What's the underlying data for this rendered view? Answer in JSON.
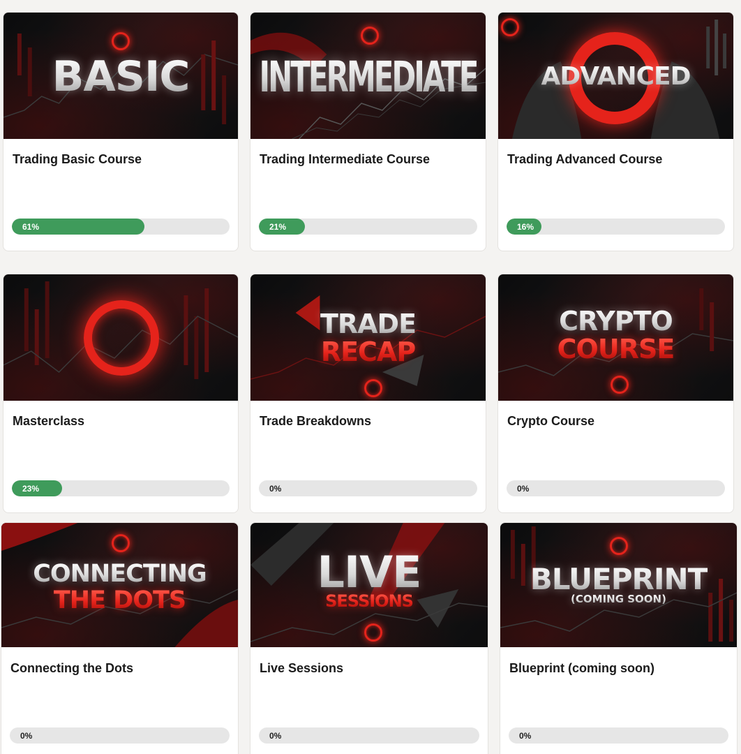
{
  "courses": [
    {
      "banner_lines": [
        "BASIC"
      ],
      "title": "Trading Basic Course",
      "progress": 61,
      "progress_label": "61%"
    },
    {
      "banner_lines": [
        "INTERMEDIATE"
      ],
      "title": "Trading Intermediate Course",
      "progress": 21,
      "progress_label": "21%"
    },
    {
      "banner_lines": [
        "ADVANCED"
      ],
      "title": "Trading Advanced Course",
      "progress": 16,
      "progress_label": "16%"
    },
    {
      "banner_lines": [],
      "title": "Masterclass",
      "progress": 23,
      "progress_label": "23%"
    },
    {
      "banner_lines": [
        "TRADE",
        "RECAP"
      ],
      "title": "Trade Breakdowns",
      "progress": 0,
      "progress_label": "0%"
    },
    {
      "banner_lines": [
        "CRYPTO",
        "COURSE"
      ],
      "title": "Crypto Course",
      "progress": 0,
      "progress_label": "0%"
    },
    {
      "banner_lines": [
        "CONNECTING",
        "THE DOTS"
      ],
      "title": "Connecting the Dots",
      "progress": 0,
      "progress_label": "0%"
    },
    {
      "banner_lines": [
        "LIVE",
        "SESSIONS"
      ],
      "title": "Live Sessions",
      "progress": 0,
      "progress_label": "0%"
    },
    {
      "banner_lines": [
        "BLUEPRINT",
        "(COMING SOON)"
      ],
      "title": "Blueprint (coming soon)",
      "progress": 0,
      "progress_label": "0%"
    }
  ],
  "colors": {
    "progress_fill": "#3f9b5b",
    "progress_track": "#e6e6e6",
    "accent_red": "#e5231b",
    "thumb_dark": "#0d0d0e"
  }
}
